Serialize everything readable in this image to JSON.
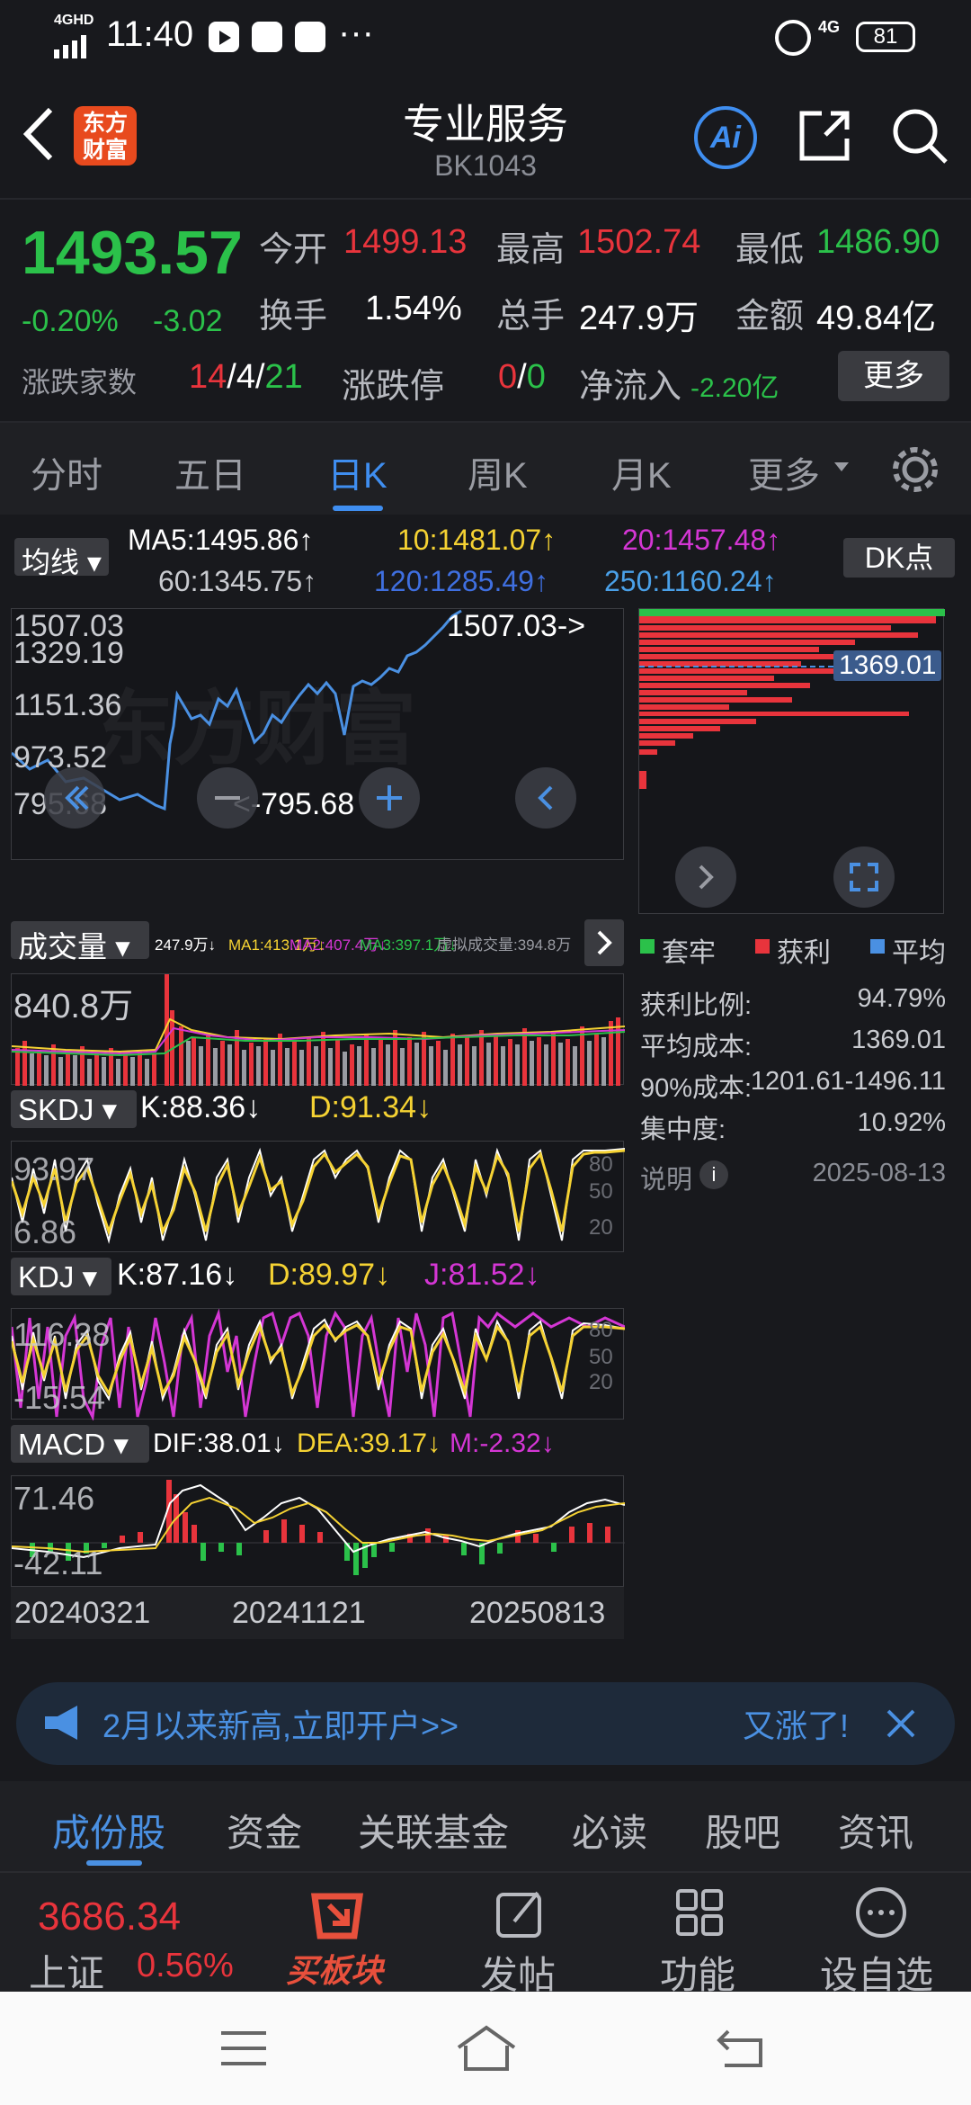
{
  "status": {
    "network": "4GHD",
    "time": "11:40",
    "net2": "4G",
    "battery": "81"
  },
  "nav": {
    "logo": "东方财富",
    "title": "专业服务",
    "code": "BK1043",
    "ai": "Ai"
  },
  "quote": {
    "price": "1493.57",
    "pct": "-0.20%",
    "chg": "-3.02",
    "open_l": "今开",
    "open": "1499.13",
    "high_l": "最高",
    "high": "1502.74",
    "low_l": "最低",
    "low": "1486.90",
    "turn_l": "换手",
    "turn": "1.54%",
    "vol_l": "总手",
    "vol": "247.9万",
    "amt_l": "金额",
    "amt": "49.84亿",
    "adv_l": "涨跌家数",
    "adv_up": "14",
    "sep1": "/",
    "adv_flat": "4",
    "sep2": "/",
    "adv_down": "21",
    "lim_l": "涨跌停",
    "lim_up": "0",
    "sep3": "/",
    "lim_down": "0",
    "flow_l": "净流入",
    "flow": "-2.20亿",
    "more": "更多"
  },
  "tabs": [
    "分时",
    "五日",
    "日K",
    "周K",
    "月K",
    "更多"
  ],
  "ma": {
    "btn": "均线",
    "ma5": "MA5:1495.86↑",
    "ma10": "10:1481.07↑",
    "ma20": "20:1457.48↑",
    "ma60": "60:1345.75↑",
    "ma120": "120:1285.49↑",
    "ma250": "250:1160.24↑",
    "dk": "DK点"
  },
  "kline": {
    "y1": "1507.03",
    "y2": "1329.19",
    "y3": "1151.36",
    "y4": "973.52",
    "y5": "795.68",
    "hi": "1507.03->",
    "lo": "<-795.68"
  },
  "chip": {
    "cost_line": "1369.01",
    "leg1": "套牢",
    "leg2": "获利",
    "leg3": "平均",
    "r1l": "获利比例:",
    "r1v": "94.79%",
    "r2l": "平均成本:",
    "r2v": "1369.01",
    "r3l": "90%成本:",
    "r3v": "1201.61-1496.11",
    "r4l": "集中度:",
    "r4v": "10.92%",
    "note": "说明",
    "date": "2025-08-13"
  },
  "vol": {
    "btn": "成交量",
    "v": "247.9万↓",
    "ma1": "MA1:413.1万↓",
    "ma2": "MA2:407.4万↓",
    "ma3": "MA3:397.1万↓",
    "virt": "虚拟成交量:394.8万",
    "y": "840.8万"
  },
  "skdj": {
    "btn": "SKDJ",
    "k": "K:88.36↓",
    "d": "D:91.34↓",
    "y1": "93.97",
    "y2": "6.86",
    "t1": "80",
    "t2": "50",
    "t3": "20"
  },
  "kdj": {
    "btn": "KDJ",
    "k": "K:87.16↓",
    "d": "D:89.97↓",
    "j": "J:81.52↓",
    "y1": "116.38",
    "y2": "-15.54",
    "t1": "80",
    "t2": "50",
    "t3": "20"
  },
  "macd": {
    "btn": "MACD",
    "dif": "DIF:38.01↓",
    "dea": "DEA:39.17↓",
    "m": "M:-2.32↓",
    "y1": "71.46",
    "y2": "-42.11"
  },
  "dates": [
    "20240321",
    "20241121",
    "20250813"
  ],
  "banner": {
    "text": "2月以来新高,立即开户>>",
    "tail": "又涨了!"
  },
  "subtabs": [
    "成份股",
    "资金",
    "关联基金",
    "必读",
    "股吧",
    "资讯"
  ],
  "bottom": {
    "idx": "3686.34",
    "idx_name": "上证",
    "idx_pct": "0.56%",
    "b1": "买板块",
    "b2": "发帖",
    "b3": "功能",
    "b4": "设自选"
  }
}
